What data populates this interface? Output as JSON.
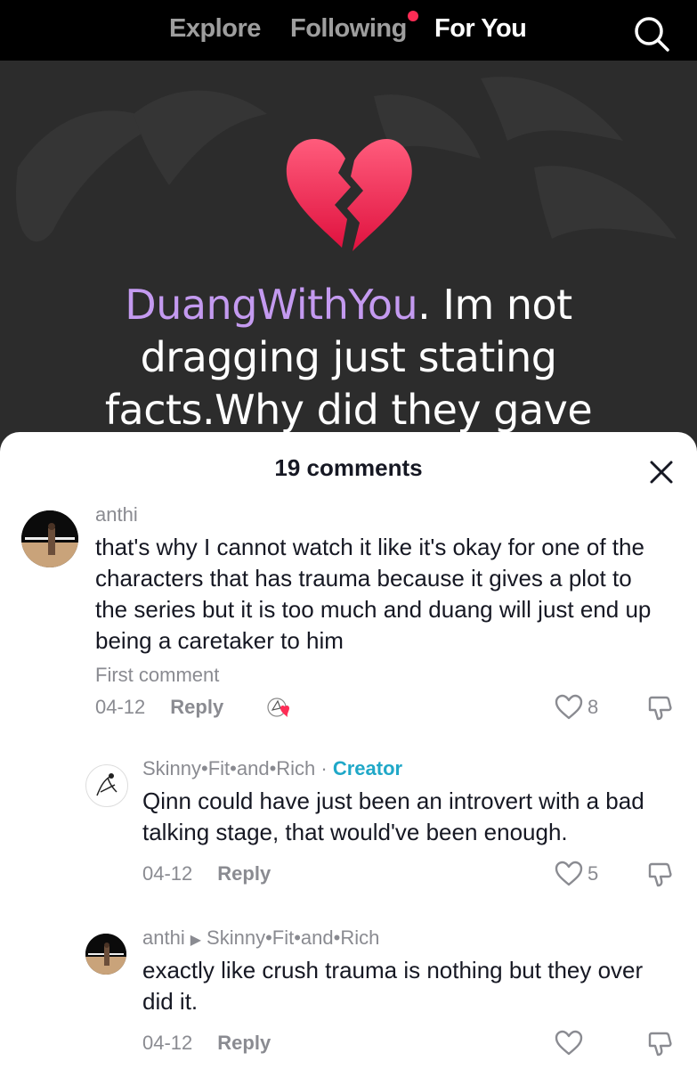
{
  "nav": {
    "tabs": [
      {
        "label": "Explore"
      },
      {
        "label": "Following"
      },
      {
        "label": "For You"
      }
    ],
    "active_tab": "For You",
    "search_icon": "search-icon",
    "notif_color": "#fe2c55"
  },
  "video": {
    "emoji": "💔",
    "caption_user": "DuangWithYou",
    "caption_text": ". Im not dragging just stating facts.Why did they gave"
  },
  "comments_sheet": {
    "title": "19 comments",
    "close_icon": "close-icon",
    "comments": [
      {
        "username": "anthi",
        "text": "that's why I cannot watch it like it's okay for one of the characters that has trauma because it gives a plot to the series but it is too much and duang will just end up being a caretaker to him",
        "badge": "First comment",
        "date": "04-12",
        "reply_label": "Reply",
        "likes": "8"
      },
      {
        "username": "Skinny•Fit•and•Rich",
        "creator_sep": " · ",
        "creator_label": "Creator",
        "text": "Qinn could have just been an introvert with a bad talking stage, that would've been enough.",
        "date": "04-12",
        "reply_label": "Reply",
        "likes": "5"
      },
      {
        "username": "anthi",
        "reply_to": "Skinny•Fit•and•Rich",
        "text": "exactly like crush trauma is nothing but they over did it.",
        "date": "04-12",
        "reply_label": "Reply",
        "likes": ""
      }
    ]
  }
}
